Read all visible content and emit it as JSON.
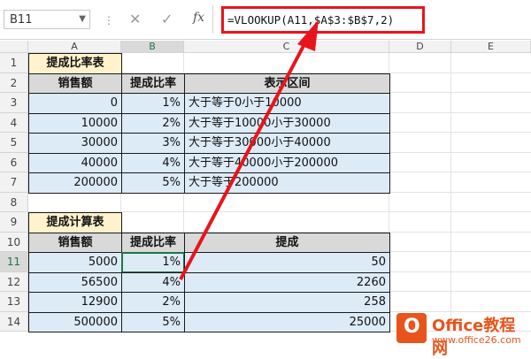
{
  "formula_bar": {
    "name_box": "B11",
    "cancel_icon": "✕",
    "enter_icon": "✓",
    "fx_label": "fx",
    "formula": "=VLOOKUP(A11,$A$3:$B$7,2)"
  },
  "columns": [
    "A",
    "B",
    "C",
    "D",
    "E"
  ],
  "rows": [
    "1",
    "2",
    "3",
    "4",
    "5",
    "6",
    "7",
    "8",
    "9",
    "10",
    "11",
    "12",
    "13",
    "14"
  ],
  "table1": {
    "title": "提成比率表",
    "headers": [
      "销售额",
      "提成比率",
      "表示区间"
    ],
    "rows": [
      [
        "0",
        "1%",
        "大于等于0小于10000"
      ],
      [
        "10000",
        "2%",
        "大于等于10000小于30000"
      ],
      [
        "30000",
        "3%",
        "大于等于30000小于40000"
      ],
      [
        "40000",
        "4%",
        "大于等于40000小于200000"
      ],
      [
        "200000",
        "5%",
        "大于等于200000"
      ]
    ]
  },
  "table2": {
    "title": "提成计算表",
    "headers": [
      "销售额",
      "提成比率",
      "提成"
    ],
    "rows": [
      [
        "5000",
        "1%",
        "50"
      ],
      [
        "56500",
        "4%",
        "2260"
      ],
      [
        "12900",
        "2%",
        "258"
      ],
      [
        "500000",
        "5%",
        "25000"
      ]
    ]
  },
  "watermark": {
    "brand": "Office教程网",
    "url": "www.office26.com"
  },
  "colors": {
    "accent_red": "#e8141c",
    "excel_green": "#217346",
    "brand_orange": "#e8541c"
  }
}
